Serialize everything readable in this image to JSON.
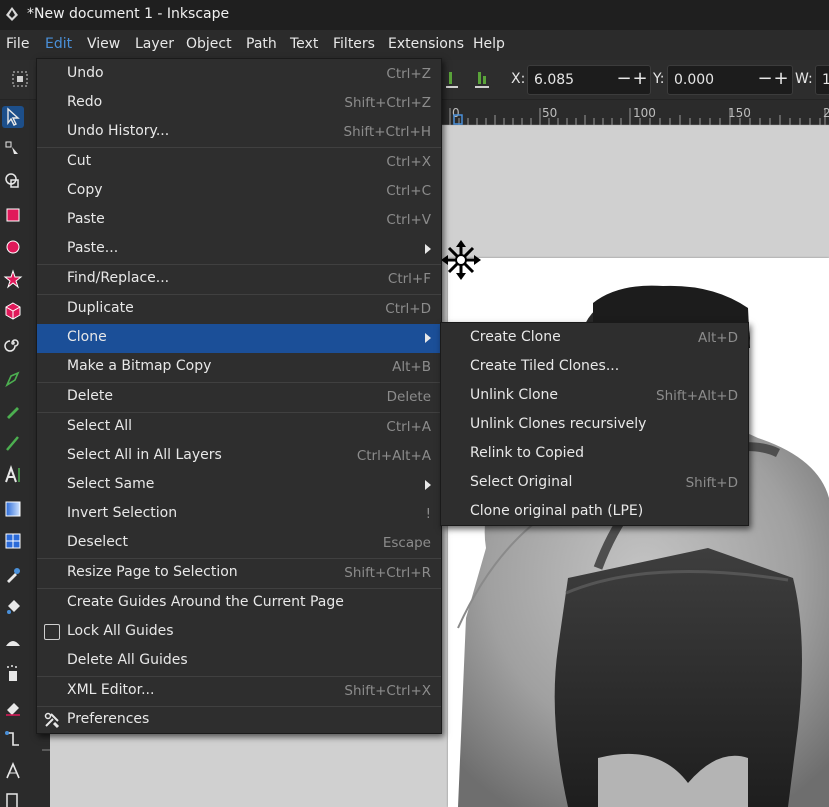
{
  "window": {
    "title": "*New document 1 - Inkscape"
  },
  "menubar": [
    "File",
    "Edit",
    "View",
    "Layer",
    "Object",
    "Path",
    "Text",
    "Filters",
    "Extensions",
    "Help"
  ],
  "toolbar": {
    "x_label": "X:",
    "x_value": "6.085",
    "y_label": "Y:",
    "y_value": "0.000",
    "w_label": "W:",
    "w_value": "1",
    "minus": "−",
    "plus": "+"
  },
  "ruler": {
    "ticks": [
      "0",
      "50",
      "100",
      "150",
      "2"
    ]
  },
  "edit_menu": [
    {
      "label": "Undo",
      "shortcut": "Ctrl+Z"
    },
    {
      "label": "Redo",
      "shortcut": "Shift+Ctrl+Z"
    },
    {
      "label": "Undo History...",
      "shortcut": "Shift+Ctrl+H"
    },
    {
      "label": "Cut",
      "shortcut": "Ctrl+X"
    },
    {
      "label": "Copy",
      "shortcut": "Ctrl+C"
    },
    {
      "label": "Paste",
      "shortcut": "Ctrl+V"
    },
    {
      "label": "Paste...",
      "shortcut": ""
    },
    {
      "label": "Find/Replace...",
      "shortcut": "Ctrl+F"
    },
    {
      "label": "Duplicate",
      "shortcut": "Ctrl+D"
    },
    {
      "label": "Clone",
      "shortcut": ""
    },
    {
      "label": "Make a Bitmap Copy",
      "shortcut": "Alt+B"
    },
    {
      "label": "Delete",
      "shortcut": "Delete"
    },
    {
      "label": "Select All",
      "shortcut": "Ctrl+A"
    },
    {
      "label": "Select All in All Layers",
      "shortcut": "Ctrl+Alt+A"
    },
    {
      "label": "Select Same",
      "shortcut": ""
    },
    {
      "label": "Invert Selection",
      "shortcut": "!"
    },
    {
      "label": "Deselect",
      "shortcut": "Escape"
    },
    {
      "label": "Resize Page to Selection",
      "shortcut": "Shift+Ctrl+R"
    },
    {
      "label": "Create Guides Around the Current Page",
      "shortcut": ""
    },
    {
      "label": "Lock All Guides",
      "shortcut": ""
    },
    {
      "label": "Delete All Guides",
      "shortcut": ""
    },
    {
      "label": "XML Editor...",
      "shortcut": "Shift+Ctrl+X"
    },
    {
      "label": "Preferences",
      "shortcut": ""
    }
  ],
  "clone_submenu": [
    {
      "label": "Create Clone",
      "shortcut": "Alt+D"
    },
    {
      "label": "Create Tiled Clones...",
      "shortcut": ""
    },
    {
      "label": "Unlink Clone",
      "shortcut": "Shift+Alt+D"
    },
    {
      "label": "Unlink Clones recursively",
      "shortcut": ""
    },
    {
      "label": "Relink to Copied",
      "shortcut": ""
    },
    {
      "label": "Select Original",
      "shortcut": "Shift+D"
    },
    {
      "label": "Clone original path (LPE)",
      "shortcut": ""
    }
  ],
  "colors": {
    "highlight": "#1b4f98",
    "menu_bg": "#2e2e2e",
    "accent_edit": "#4a90d9"
  }
}
